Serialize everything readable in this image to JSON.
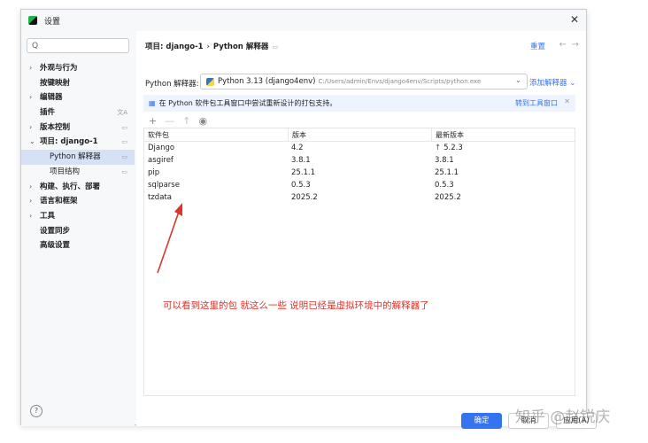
{
  "window": {
    "title": "设置",
    "close_glyph": "✕"
  },
  "sidebar": {
    "search_glyph": "Q",
    "items": [
      {
        "label": "外观与行为",
        "arrow": "›",
        "side_icon": ""
      },
      {
        "label": "按键映射",
        "arrow": "",
        "side_icon": ""
      },
      {
        "label": "编辑器",
        "arrow": "›",
        "side_icon": ""
      },
      {
        "label": "插件",
        "arrow": "",
        "side_icon": "文A"
      },
      {
        "label": "版本控制",
        "arrow": "›",
        "side_icon": "▭"
      },
      {
        "label": "项目: django-1",
        "arrow": "⌄",
        "side_icon": "▭"
      },
      {
        "label": "Python 解释器",
        "arrow": "",
        "side_icon": "▭"
      },
      {
        "label": "项目结构",
        "arrow": "",
        "side_icon": "▭"
      },
      {
        "label": "构建、执行、部署",
        "arrow": "›",
        "side_icon": ""
      },
      {
        "label": "语言和框架",
        "arrow": "›",
        "side_icon": ""
      },
      {
        "label": "工具",
        "arrow": "›",
        "side_icon": ""
      },
      {
        "label": "设置同步",
        "arrow": "",
        "side_icon": ""
      },
      {
        "label": "高级设置",
        "arrow": "",
        "side_icon": ""
      }
    ],
    "help_glyph": "?"
  },
  "header": {
    "crumb_project": "项目: django-1",
    "crumb_sep": "›",
    "crumb_page": "Python 解释器",
    "pin_glyph": "▭",
    "reset_label": "重置",
    "back_glyph": "←",
    "fwd_glyph": "→"
  },
  "interpreter": {
    "label": "Python 解释器:",
    "name": "Python 3.13 (django4env)",
    "path": "C:/Users/admin/Envs/django4env/Scripts/python.exe",
    "caret": "⌄",
    "add_label": "添加解释器 ⌄"
  },
  "banner": {
    "icon": "▦",
    "text": "在 Python 软件包工具窗口中尝试重新设计的打包支持。",
    "link": "转到工具窗口",
    "close": "✕"
  },
  "toolbar": {
    "add": "+",
    "remove": "—",
    "upgrade": "↑",
    "eye": "◉"
  },
  "table": {
    "columns": [
      "软件包",
      "版本",
      "最新版本"
    ],
    "upgrade_glyph": "↑",
    "rows": [
      {
        "name": "Django",
        "version": "4.2",
        "latest": "5.2.3",
        "upgrade": true
      },
      {
        "name": "asgiref",
        "version": "3.8.1",
        "latest": "3.8.1",
        "upgrade": false
      },
      {
        "name": "pip",
        "version": "25.1.1",
        "latest": "25.1.1",
        "upgrade": false
      },
      {
        "name": "sqlparse",
        "version": "0.5.3",
        "latest": "0.5.3",
        "upgrade": false
      },
      {
        "name": "tzdata",
        "version": "2025.2",
        "latest": "2025.2",
        "upgrade": false
      }
    ]
  },
  "annotation": {
    "text": "可以看到这里的包 就这么一些  说明已经是虚拟环境中的解释器了",
    "color": "#d9362c"
  },
  "buttons": {
    "ok": "确定",
    "cancel": "取消",
    "apply": "应用(A)"
  },
  "watermark": "知乎 @赵锐庆",
  "colors": {
    "accent": "#3574f0",
    "selected_bg": "#d5e1f5",
    "banner_bg": "#edf3ff"
  }
}
